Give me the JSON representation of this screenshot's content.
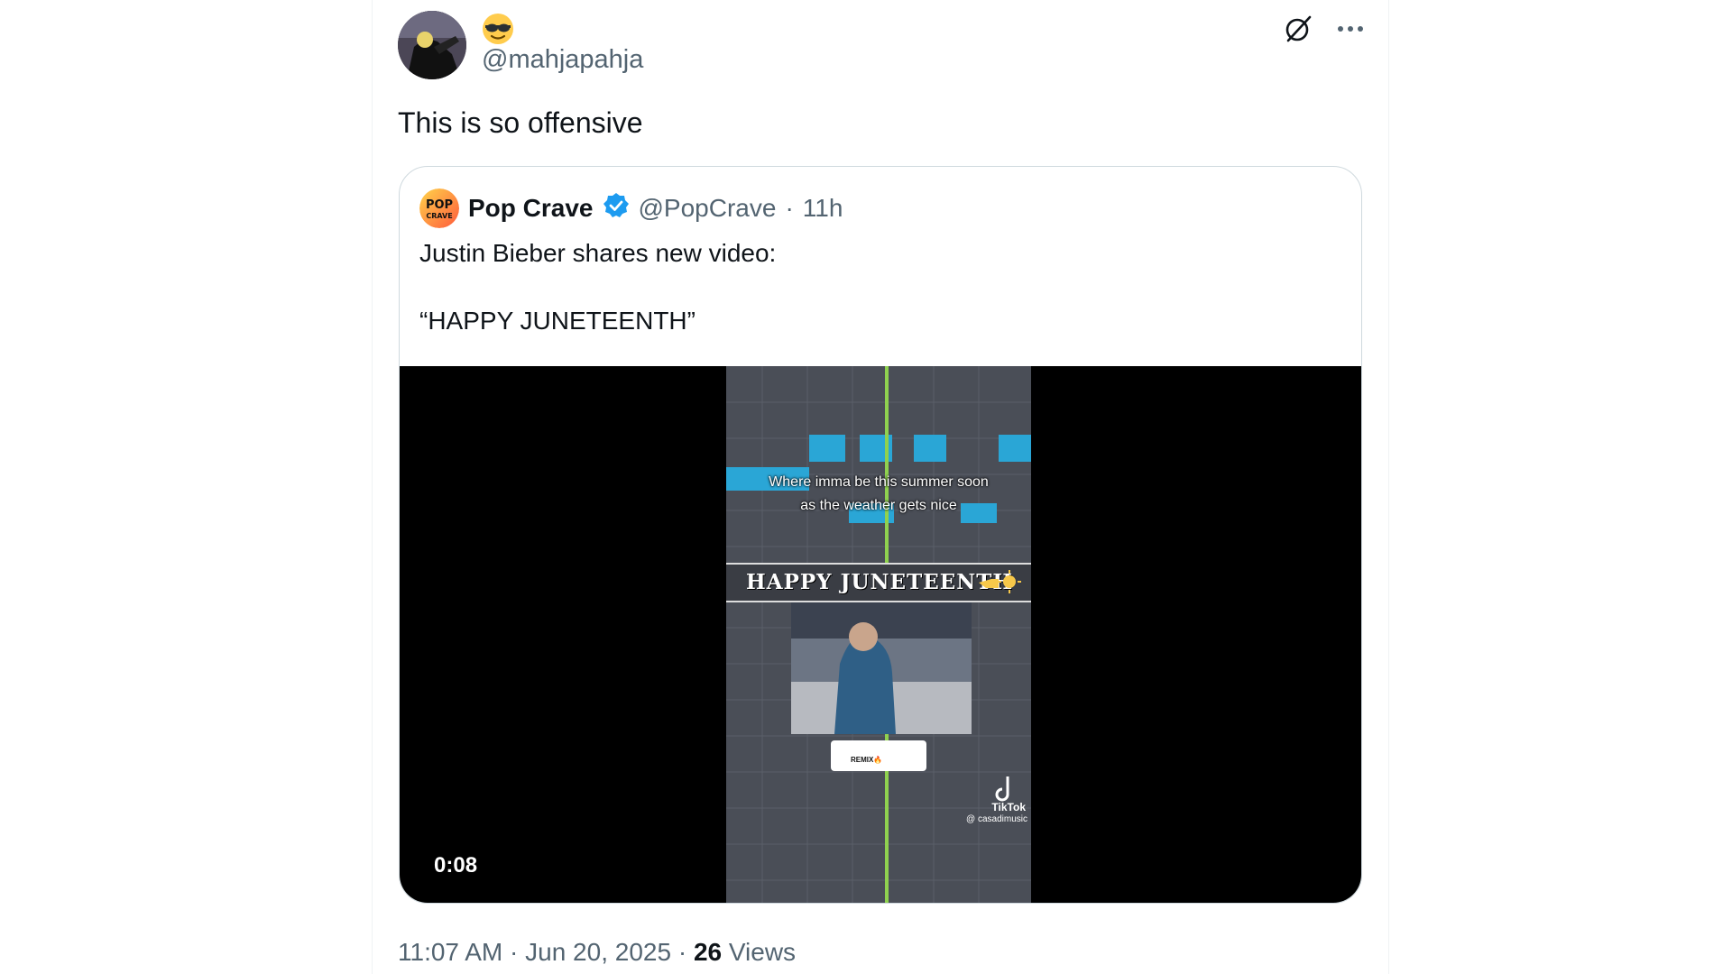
{
  "tweet": {
    "handle": "@mahjapahja",
    "text": "This is so offensive",
    "emoji": "😎"
  },
  "quote": {
    "name": "Pop Crave",
    "handle": "@PopCrave",
    "sep": "·",
    "age": "11h",
    "avatar_text": "POP CRAVE",
    "line1": "Justin Bieber shares new video:",
    "line2": "“HAPPY JUNETEENTH”"
  },
  "video": {
    "duration": "0:08",
    "caption_1": "Where imma be this summer soon",
    "caption_2": "as the weather gets nice",
    "banner": "HAPPY JUNETEENTH",
    "tiktok_label": "TikTok",
    "tiktok_user": "@ casadimusic",
    "remix_label": "REMIX🔥"
  },
  "footer": {
    "time": "11:07 AM",
    "date": "Jun 20, 2025",
    "views_count": "26",
    "views_label": "Views",
    "sep": "·"
  },
  "colors": {
    "accent": "#1d9bf0",
    "muted": "#536471",
    "text": "#0f1419"
  }
}
